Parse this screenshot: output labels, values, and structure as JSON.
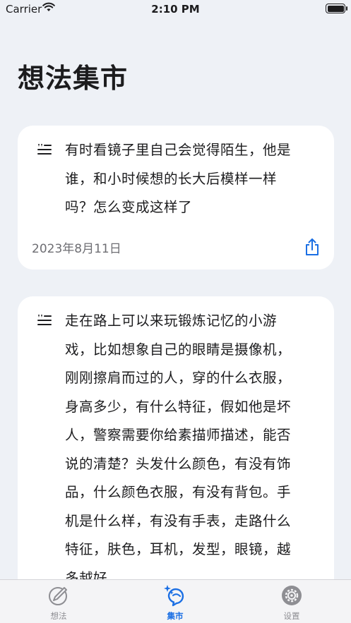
{
  "status_bar": {
    "carrier": "Carrier",
    "time": "2:10 PM"
  },
  "page": {
    "title": "想法集市"
  },
  "cards": [
    {
      "text": "有时看镜子里自己会觉得陌生，他是谁，和小时候想的长大后模样一样吗？怎么变成这样了",
      "date": "2023年8月11日"
    },
    {
      "text": "走在路上可以来玩锻炼记忆的小游戏，比如想象自己的眼睛是摄像机，刚刚擦肩而过的人，穿的什么衣服，身高多少，有什么特征，假如他是坏人，警察需要你给素描师描述，能否说的清楚？头发什么颜色，有没有饰品，什么颜色衣服，有没有背包。手机是什么样，有没有手表，走路什么特征，肤色，耳机，发型，眼镜，越多越好。"
    }
  ],
  "tabs": [
    {
      "label": "想法",
      "icon": "pencil-circle-icon",
      "selected": false
    },
    {
      "label": "集市",
      "icon": "sparkle-bubble-icon",
      "selected": true
    },
    {
      "label": "设置",
      "icon": "gear-icon",
      "selected": false
    }
  ],
  "colors": {
    "accent": "#1b6fe4",
    "background": "#eef1f6",
    "card": "#ffffff",
    "secondary_text": "#6e6e73"
  }
}
